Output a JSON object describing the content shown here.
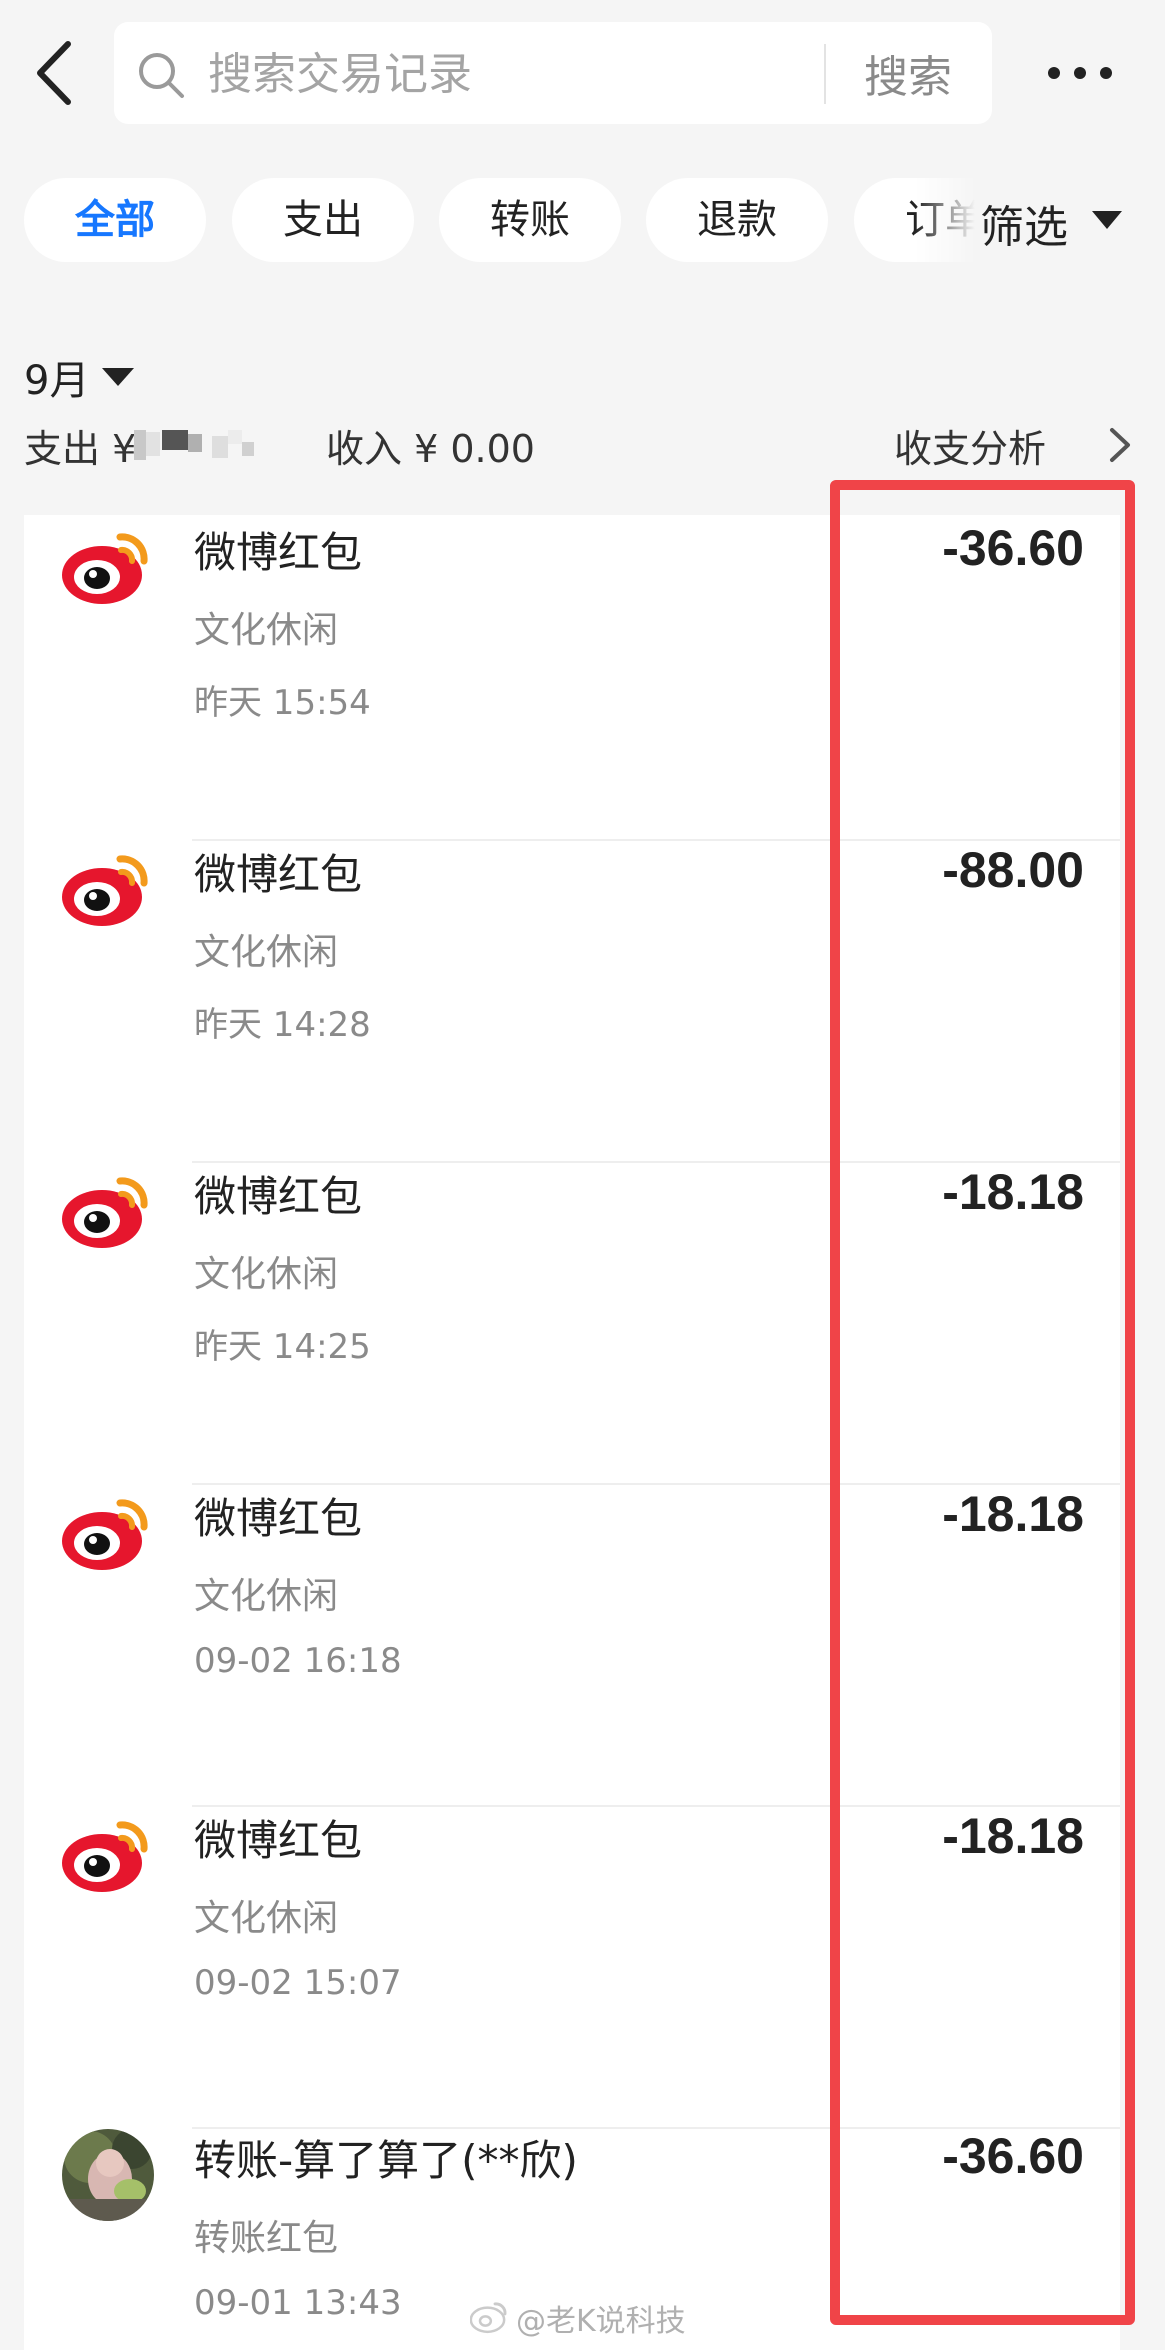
{
  "header": {
    "back_icon": "back-arrow-icon",
    "search_placeholder": "搜索交易记录",
    "search_icon": "search-icon",
    "search_button": "搜索",
    "more_icon": "more-dots-icon"
  },
  "tabs": [
    {
      "label": "全部",
      "active": true
    },
    {
      "label": "支出",
      "active": false
    },
    {
      "label": "转账",
      "active": false
    },
    {
      "label": "退款",
      "active": false
    },
    {
      "label": "订单",
      "active": false
    }
  ],
  "filter": {
    "label": "筛选",
    "icon": "triangle-down-icon"
  },
  "summary": {
    "month": "9月",
    "expense_label": "支出 ¥",
    "income_label": "收入 ¥ 0.00",
    "analysis_label": "收支分析"
  },
  "transactions": [
    {
      "icon": "weibo-logo-icon",
      "title": "微博红包",
      "category": "文化休闲",
      "time": "昨天 15:54",
      "amount": "-36.60"
    },
    {
      "icon": "weibo-logo-icon",
      "title": "微博红包",
      "category": "文化休闲",
      "time": "昨天 14:28",
      "amount": "-88.00"
    },
    {
      "icon": "weibo-logo-icon",
      "title": "微博红包",
      "category": "文化休闲",
      "time": "昨天 14:25",
      "amount": "-18.18"
    },
    {
      "icon": "weibo-logo-icon",
      "title": "微博红包",
      "category": "文化休闲",
      "time": "09-02 16:18",
      "amount": "-18.18"
    },
    {
      "icon": "weibo-logo-icon",
      "title": "微博红包",
      "category": "文化休闲",
      "time": "09-02 15:07",
      "amount": "-18.18"
    },
    {
      "icon": "user-avatar-icon",
      "title": "转账-算了算了(**欣)",
      "category": "转账红包",
      "time": "09-01 13:43",
      "amount": "-36.60"
    }
  ],
  "annotation": {
    "color": "#f04448"
  },
  "watermark": {
    "text": "@老K说科技",
    "icon": "weibo-logo-icon"
  },
  "colors": {
    "accent": "#1677ff",
    "background": "#f5f5f5"
  }
}
